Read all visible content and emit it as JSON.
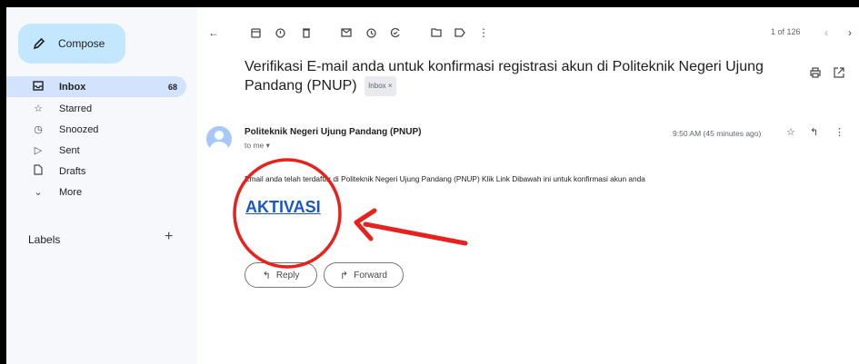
{
  "sidebar": {
    "compose_label": "Compose",
    "items": [
      {
        "label": "Inbox",
        "count": "68",
        "icon": "inbox-icon"
      },
      {
        "label": "Starred",
        "icon": "star-icon"
      },
      {
        "label": "Snoozed",
        "icon": "clock-icon"
      },
      {
        "label": "Sent",
        "icon": "send-icon"
      },
      {
        "label": "Drafts",
        "icon": "draft-icon"
      },
      {
        "label": "More",
        "icon": "chevron-down-icon"
      }
    ],
    "labels_heading": "Labels",
    "labels_add": "+"
  },
  "toolbar": {
    "pager": "1 of 126",
    "icons": [
      "back-arrow-icon",
      "archive-icon",
      "report-spam-icon",
      "delete-icon",
      "mark-unread-icon",
      "snooze-icon",
      "add-task-icon",
      "move-to-icon",
      "label-icon",
      "more-vert-icon",
      "newer-icon",
      "older-icon"
    ]
  },
  "email": {
    "subject": "Verifikasi E-mail anda untuk konfirmasi registrasi akun di Politeknik Negeri Ujung Pandang (PNUP)",
    "inbox_badge": "Inbox ×",
    "sender": "Politeknik Negeri Ujung Pandang (PNUP)",
    "to": "to me ▾",
    "time": "9:50 AM (45 minutes ago)",
    "body": "Email anda telah terdaftar di Politeknik Negeri Ujung Pandang (PNUP) Klik Link Dibawah ini untuk konfirmasi akun anda",
    "link_label": "AKTIVASI",
    "reply_label": "Reply",
    "forward_label": "Forward"
  },
  "colors": {
    "sidebar_bg": "#f6f8fc",
    "compose_bg": "#c2e7ff",
    "active_item_bg": "#d3e3fd",
    "link": "#1a56c8",
    "annotation": "#e8211d"
  }
}
